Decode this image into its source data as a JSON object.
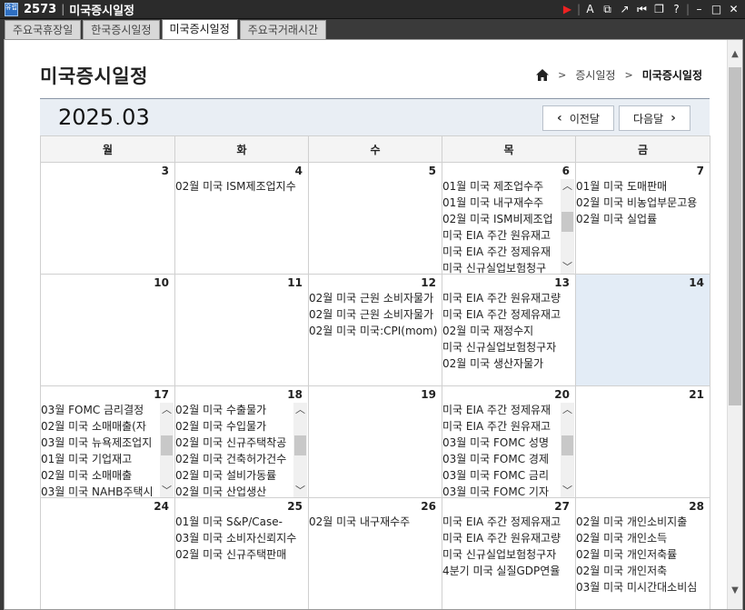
{
  "window": {
    "screen_no": "2573",
    "title": "미국증시일정",
    "icon_label": "유럽"
  },
  "tabs": [
    {
      "label": "주요국휴장일"
    },
    {
      "label": "한국증시일정"
    },
    {
      "label": "미국증시일정",
      "active": true
    },
    {
      "label": "주요국거래시간"
    }
  ],
  "page": {
    "title": "미국증시일정",
    "breadcrumb": [
      "증시일정",
      "미국증시일정"
    ]
  },
  "calendar": {
    "year": "2025",
    "month": "03",
    "prev_label": "이전달",
    "next_label": "다음달",
    "weekdays": [
      "월",
      "화",
      "수",
      "목",
      "금"
    ],
    "weeks": [
      [
        {
          "day": "3",
          "events": []
        },
        {
          "day": "4",
          "events": [
            "02월 미국 ISM제조업지수"
          ]
        },
        {
          "day": "5",
          "events": []
        },
        {
          "day": "6",
          "scroll": true,
          "events": [
            "01월 미국 제조업수주",
            "01월 미국 내구재수주",
            "02월 미국 ISM비제조업",
            "미국 EIA 주간 원유재고",
            "미국 EIA 주간 정제유재",
            "미국 신규실업보험청구"
          ]
        },
        {
          "day": "7",
          "events": [
            "01월 미국 도매판매",
            "02월 미국 비농업부문고용",
            "02월 미국 실업률"
          ]
        }
      ],
      [
        {
          "day": "10",
          "events": []
        },
        {
          "day": "11",
          "events": []
        },
        {
          "day": "12",
          "events": [
            "02월 미국 근원 소비자물가",
            "02월 미국 근원 소비자물가",
            "02월 미국 미국:CPI(mom)"
          ]
        },
        {
          "day": "13",
          "events": [
            "미국 EIA 주간 원유재고량",
            "미국 EIA 주간 정제유재고",
            "02월 미국 재정수지",
            "미국 신규실업보험청구자",
            "02월 미국 생산자물가"
          ]
        },
        {
          "day": "14",
          "today": true,
          "events": []
        }
      ],
      [
        {
          "day": "17",
          "scroll": true,
          "events": [
            "03월 FOMC 금리결정",
            "02월 미국 소매매출(자",
            "03월 미국 뉴욕제조업지",
            "01월 미국 기업재고",
            "02월 미국 소매매출",
            "03월 미국 NAHB주택시"
          ]
        },
        {
          "day": "18",
          "scroll": true,
          "events": [
            "02월 미국 수출물가",
            "02월 미국 수입물가",
            "02월 미국 신규주택착공",
            "02월 미국 건축허가건수",
            "02월 미국 설비가동률",
            "02월 미국 산업생산"
          ]
        },
        {
          "day": "19",
          "events": []
        },
        {
          "day": "20",
          "scroll": true,
          "events": [
            "미국 EIA 주간 정제유재",
            "미국 EIA 주간 원유재고",
            "03월 미국 FOMC 성명",
            "03월 미국 FOMC 경제",
            "03월 미국 FOMC 금리",
            "03월 미국 FOMC 기자"
          ]
        },
        {
          "day": "21",
          "events": []
        }
      ],
      [
        {
          "day": "24",
          "events": []
        },
        {
          "day": "25",
          "events": [
            "01월 미국 S&P/Case-",
            "03월 미국 소비자신뢰지수",
            "02월 미국 신규주택판매"
          ]
        },
        {
          "day": "26",
          "events": [
            "02월 미국 내구재수주"
          ]
        },
        {
          "day": "27",
          "events": [
            "미국 EIA 주간 정제유재고",
            "미국 EIA 주간 원유재고량",
            "미국 신규실업보험청구자",
            "4분기 미국 실질GDP연율"
          ]
        },
        {
          "day": "28",
          "events": [
            "02월 미국 개인소비지출",
            "02월 미국 개인소득",
            "02월 미국 개인저축률",
            "02월 미국 개인저축",
            "03월 미국 미시간대소비심"
          ]
        }
      ]
    ]
  }
}
